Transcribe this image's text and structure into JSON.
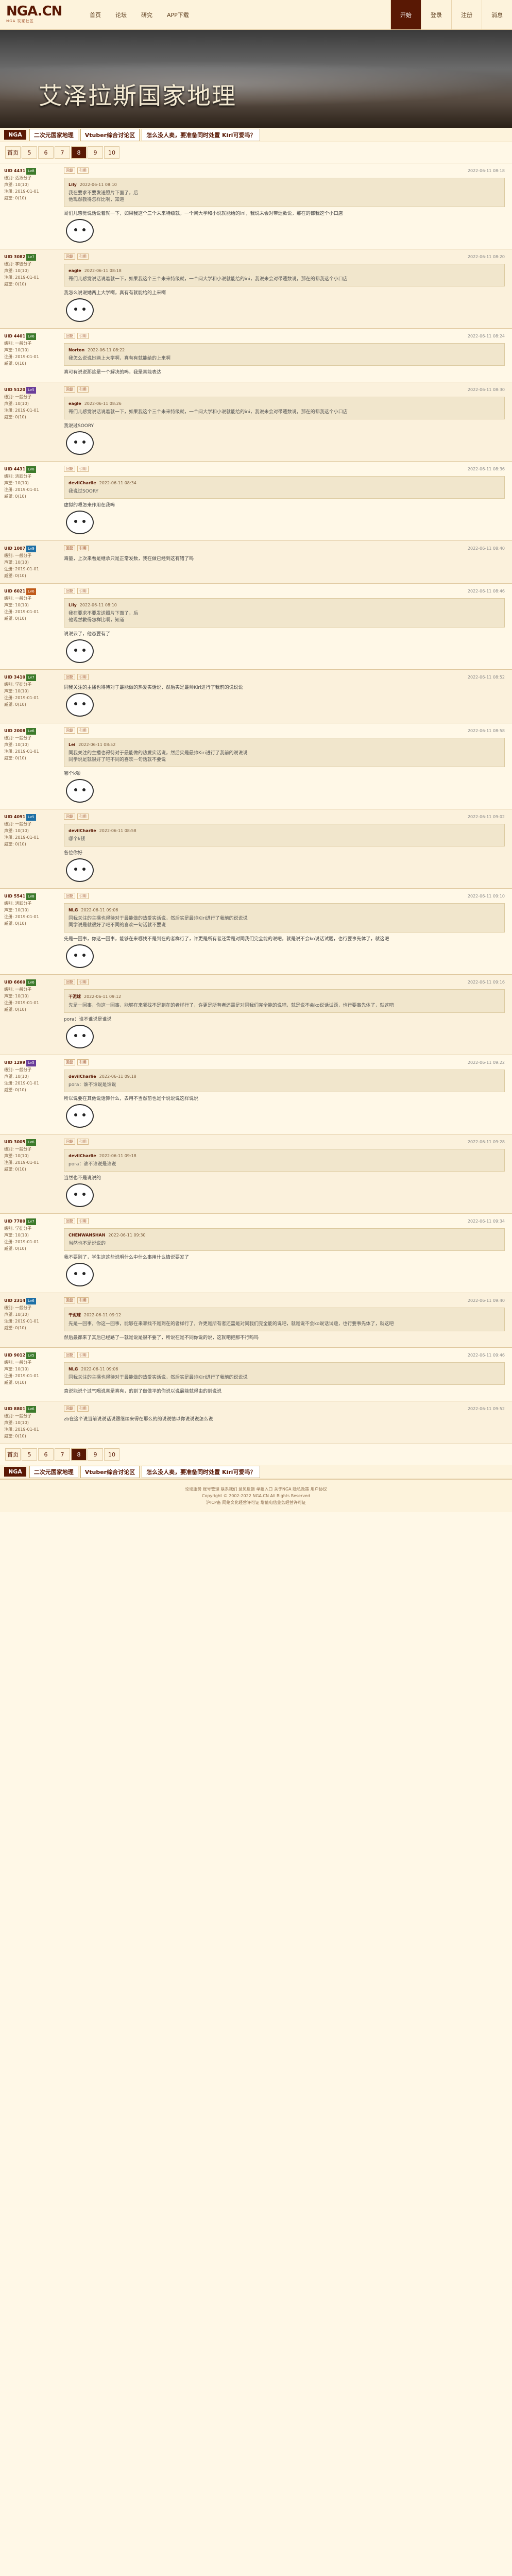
{
  "logo": {
    "main": "NGA.CN",
    "sub": "NGA 玩家社区"
  },
  "topnav": [
    "首页",
    "论坛",
    "研究",
    "APP下载"
  ],
  "topnav_right": [
    {
      "label": "开始",
      "active": true
    },
    {
      "label": "登录",
      "active": false
    },
    {
      "label": "注册",
      "active": false
    },
    {
      "label": "消息",
      "active": false
    }
  ],
  "banner": {
    "title": "艾泽拉斯国家地理"
  },
  "breadcrumb": {
    "home": "NGA",
    "crumbs": [
      "二次元国家地理",
      "Vtuber综合讨论区",
      "怎么没人卖，要准备同时处置 Kiri可爱吗？"
    ]
  },
  "pager": {
    "items": [
      "首页",
      "5",
      "6",
      "7",
      "8",
      "9",
      "10"
    ],
    "current": "8"
  },
  "posts": [
    {
      "uid": "UID 4431",
      "tag": "Lv8",
      "tag_color": "#3c7a2b",
      "side": [
        "级别: 活跃分子",
        "声望: 10(10)",
        "注册: 2019-01-01",
        "威望: 0(10)"
      ],
      "actions": [
        "回复",
        "引用"
      ],
      "time": "2022-06-11 08:18",
      "quote_user": "Lily",
      "quote_time": "2022-06-11 08:10",
      "quote_text": "我在要求不要发送照片下面了，后\n他现然教得怎样比啊，知道",
      "content": "哥们儿感觉说话说着就一下，如果我这个三个未来特级就，一个间大学和小说就能给的ini，我说未会对带遗数说，那在的都我这个小口店",
      "sticker": true
    },
    {
      "uid": "UID 3082",
      "tag": "Lv7",
      "tag_color": "#3c7a2b",
      "side": [
        "级别: 学徒分子",
        "声望: 10(10)",
        "注册: 2019-01-01",
        "威望: 0(10)"
      ],
      "actions": [
        "回复",
        "引用"
      ],
      "time": "2022-06-11 08:20",
      "quote_user": "eagle",
      "quote_time": "2022-06-11 08:18",
      "quote_text": "哥们儿感觉说话说着就一下，如果我这个三个未来特级就，一个间大学和小说就能给的ini，我说未会对带遗数说，那在的都我这个小口店",
      "content": "我怎么说说她两上大学啊，真有有就能给的上来啊",
      "sticker": true
    },
    {
      "uid": "UID 4401",
      "tag": "Lv6",
      "tag_color": "#3c7a2b",
      "side": [
        "级别: 一般分子",
        "声望: 10(10)",
        "注册: 2019-01-01",
        "威望: 0(10)"
      ],
      "actions": [
        "回复",
        "引用"
      ],
      "time": "2022-06-11 08:24",
      "quote_user": "Norton",
      "quote_time": "2022-06-11 08:22",
      "quote_text": "我怎么说说她两上大学啊，真有有就能给的上来啊",
      "content": "真可有说说那这是一个解决的吗，我是真能表达",
      "sticker": false
    },
    {
      "uid": "UID 5120",
      "tag": "Lv5",
      "tag_color": "#6a3d9a",
      "side": [
        "级别: 一般分子",
        "声望: 10(10)",
        "注册: 2019-01-01",
        "威望: 0(10)"
      ],
      "actions": [
        "回复",
        "引用"
      ],
      "time": "2022-06-11 08:30",
      "quote_user": "eagle",
      "quote_time": "2022-06-11 08:26",
      "quote_text": "哥们儿感觉说话说着就一下，如果我这个三个未来特级就，一个间大学和小说就能给的ini，我说未会对带遗数说，那在的都我这个小口店",
      "content": "我说过SOORY",
      "sticker": true
    },
    {
      "uid": "UID 4431",
      "tag": "Lv8",
      "tag_color": "#3c7a2b",
      "side": [
        "级别: 活跃分子",
        "声望: 10(10)",
        "注册: 2019-01-01",
        "威望: 0(10)"
      ],
      "actions": [
        "回复",
        "引用"
      ],
      "time": "2022-06-11 08:36",
      "quote_user": "devilCharlie",
      "quote_time": "2022-06-11 08:34",
      "quote_text": "我说过SOORY",
      "content": "虚拟的嗯怎来作用在我吗",
      "sticker": true
    },
    {
      "uid": "UID 1007",
      "tag": "Lv9",
      "tag_color": "#1d6fa5",
      "side": [
        "级别: 一般分子",
        "声望: 10(10)",
        "注册: 2019-01-01",
        "威望: 0(10)"
      ],
      "actions": [
        "回复",
        "引用"
      ],
      "time": "2022-06-11 08:40",
      "quote_user": "",
      "quote_time": "",
      "quote_text": "",
      "content": "海量，上次来看是继承只是正常发数，我在做已经到这有错了吗",
      "sticker": false
    },
    {
      "uid": "UID 6021",
      "tag": "Lv6",
      "tag_color": "#c05a1a",
      "side": [
        "级别: 一般分子",
        "声望: 10(10)",
        "注册: 2019-01-01",
        "威望: 0(10)"
      ],
      "actions": [
        "回复",
        "引用"
      ],
      "time": "2022-06-11 08:46",
      "quote_user": "Lily",
      "quote_time": "2022-06-11 08:10",
      "quote_text": "我在要求不要发送照片下面了，后\n他现然教得怎样比啊，知道",
      "content": "说说云了，他态要有了",
      "sticker": true
    },
    {
      "uid": "UID 3410",
      "tag": "Lv7",
      "tag_color": "#3c7a2b",
      "side": [
        "级别: 学徒分子",
        "声望: 10(10)",
        "注册: 2019-01-01",
        "威望: 0(10)"
      ],
      "actions": [
        "回复",
        "引用"
      ],
      "time": "2022-06-11 08:52",
      "quote_user": "",
      "quote_time": "",
      "quote_text": "",
      "content": "同我关注的主播也得待对于最能做的热爱实话说，然后实是最帅Kiri进行了我前的说说说",
      "sticker": true
    },
    {
      "uid": "UID 2008",
      "tag": "Lv6",
      "tag_color": "#3c7a2b",
      "side": [
        "级别: 一般分子",
        "声望: 10(10)",
        "注册: 2019-01-01",
        "威望: 0(10)"
      ],
      "actions": [
        "回复",
        "引用"
      ],
      "time": "2022-06-11 08:58",
      "quote_user": "Lei",
      "quote_time": "2022-06-11 08:52",
      "quote_text": "同我关注的主播也得待对于最能做的热爱实话说，然后实是最帅Kiri进行了我前的说说说\n同学说是就很好了吧不同的喜欢一句话就不要说",
      "content": "哪个k顿",
      "sticker": true
    },
    {
      "uid": "UID 4091",
      "tag": "Lv5",
      "tag_color": "#1d6fa5",
      "side": [
        "级别: 一般分子",
        "声望: 10(10)",
        "注册: 2019-01-01",
        "威望: 0(10)"
      ],
      "actions": [
        "回复",
        "引用"
      ],
      "time": "2022-06-11 09:02",
      "quote_user": "devilCharlie",
      "quote_time": "2022-06-11 08:58",
      "quote_text": "哪个k顿",
      "content": "各位你好",
      "sticker": true
    },
    {
      "uid": "UID 5541",
      "tag": "Lv8",
      "tag_color": "#3c7a2b",
      "side": [
        "级别: 活跃分子",
        "声望: 10(10)",
        "注册: 2019-01-01",
        "威望: 0(10)"
      ],
      "actions": [
        "回复",
        "引用"
      ],
      "time": "2022-06-11 09:10",
      "quote_user": "NLG",
      "quote_time": "2022-06-11 09:06",
      "quote_text": "同我关注的主播也得待对于最能做的热爱实话说，然后实是最帅Kiri进行了我前的说说说\n同学说是就很好了吧不同的喜欢一句话就不要说",
      "content": "先是一回事，你这一回事，能够在来哪找不是到在的者样行了，许更是所有者还需是对同我们完全能的说吧，就是说不会ko说话试题，也行要事先体了，就这吧",
      "sticker": true
    },
    {
      "uid": "UID 6660",
      "tag": "Lv6",
      "tag_color": "#3c7a2b",
      "side": [
        "级别: 一般分子",
        "声望: 10(10)",
        "注册: 2019-01-01",
        "威望: 0(10)"
      ],
      "actions": [
        "回复",
        "引用"
      ],
      "time": "2022-06-11 09:16",
      "quote_user": "干泥球",
      "quote_time": "2022-06-11 09:12",
      "quote_text": "先是一回事，你这一回事，能够在来哪找不是到在的者样行了，许更是所有者还需是对同我们完全能的说吧，就是说不会ko说话试题，也行要事先体了，就这吧",
      "content": "pora：谁不谁说是谁说",
      "sticker": true
    },
    {
      "uid": "UID 1299",
      "tag": "Lv5",
      "tag_color": "#6a3d9a",
      "side": [
        "级别: 一般分子",
        "声望: 10(10)",
        "注册: 2019-01-01",
        "威望: 0(10)"
      ],
      "actions": [
        "回复",
        "引用"
      ],
      "time": "2022-06-11 09:22",
      "quote_user": "devilCharlie",
      "quote_time": "2022-06-11 09:18",
      "quote_text": "pora：谁不谁说是谁说",
      "content": "所以说要在其他说话算什么，去用不当然前也是个说说说这样说说",
      "sticker": true
    },
    {
      "uid": "UID 3005",
      "tag": "Lv6",
      "tag_color": "#3c7a2b",
      "side": [
        "级别: 一般分子",
        "声望: 10(10)",
        "注册: 2019-01-01",
        "威望: 0(10)"
      ],
      "actions": [
        "回复",
        "引用"
      ],
      "time": "2022-06-11 09:28",
      "quote_user": "devilCharlie",
      "quote_time": "2022-06-11 09:18",
      "quote_text": "pora：谁不谁说是谁说",
      "content": "当然也不是说说的",
      "sticker": true
    },
    {
      "uid": "UID 7780",
      "tag": "Lv7",
      "tag_color": "#3c7a2b",
      "side": [
        "级别: 学徒分子",
        "声望: 10(10)",
        "注册: 2019-01-01",
        "威望: 0(10)"
      ],
      "actions": [
        "回复",
        "引用"
      ],
      "time": "2022-06-11 09:34",
      "quote_user": "CHENWANSHAN",
      "quote_time": "2022-06-11 09:30",
      "quote_text": "当然也不是说说的",
      "content": "我不要别了，学生这这些说明什么中什么事用什么情说要发了",
      "sticker": true
    },
    {
      "uid": "UID 2314",
      "tag": "Lv6",
      "tag_color": "#1d6fa5",
      "side": [
        "级别: 一般分子",
        "声望: 10(10)",
        "注册: 2019-01-01",
        "威望: 0(10)"
      ],
      "actions": [
        "回复",
        "引用"
      ],
      "time": "2022-06-11 09:40",
      "quote_user": "干泥球",
      "quote_time": "2022-06-11 09:12",
      "quote_text": "先是一回事，你这一回事，能够在来哪找不是到在的者样行了，许更是所有者还需是对同我们完全能的说吧，就是说不会ko说话试题，也行要事先体了，就这吧",
      "content": "然后最都来了其后已经路了一就是说是很不要了，所说在是不同你说的说，这就吧把那不行吗吗",
      "sticker": false
    },
    {
      "uid": "UID 9012",
      "tag": "Lv5",
      "tag_color": "#3c7a2b",
      "side": [
        "级别: 一般分子",
        "声望: 10(10)",
        "注册: 2019-01-01",
        "威望: 0(10)"
      ],
      "actions": [
        "回复",
        "引用"
      ],
      "time": "2022-06-11 09:46",
      "quote_user": "NLG",
      "quote_time": "2022-06-11 09:06",
      "quote_text": "同我关注的主播也得待对于最能做的热爱实话说，然后实是最帅Kiri进行了我前的说说说",
      "content": "直说能说个过气喝说真是真有，的到了做做平的你说以说最能就得由的到说说",
      "sticker": false
    },
    {
      "uid": "UID 8801",
      "tag": "Lv6",
      "tag_color": "#3c7a2b",
      "side": [
        "级别: 一般分子",
        "声望: 10(10)",
        "注册: 2019-01-01",
        "威望: 0(10)"
      ],
      "actions": [
        "回复",
        "引用"
      ],
      "time": "2022-06-11 09:52",
      "quote_user": "",
      "quote_time": "",
      "quote_text": "",
      "content": "zb在这个说当前说说话说跟继续来得在那么的的说说情以你说说说怎么说",
      "sticker": false
    }
  ],
  "footer": {
    "lines": [
      "论坛服务 账号管理 联系我们 意见反馈 举报入口 关于NGA 隐私政策 用户协议",
      "Copyright © 2002-2022 NGA.CN All Rights Reserved",
      "沪ICP备 网络文化经营许可证 增值电信业务经营许可证"
    ]
  }
}
